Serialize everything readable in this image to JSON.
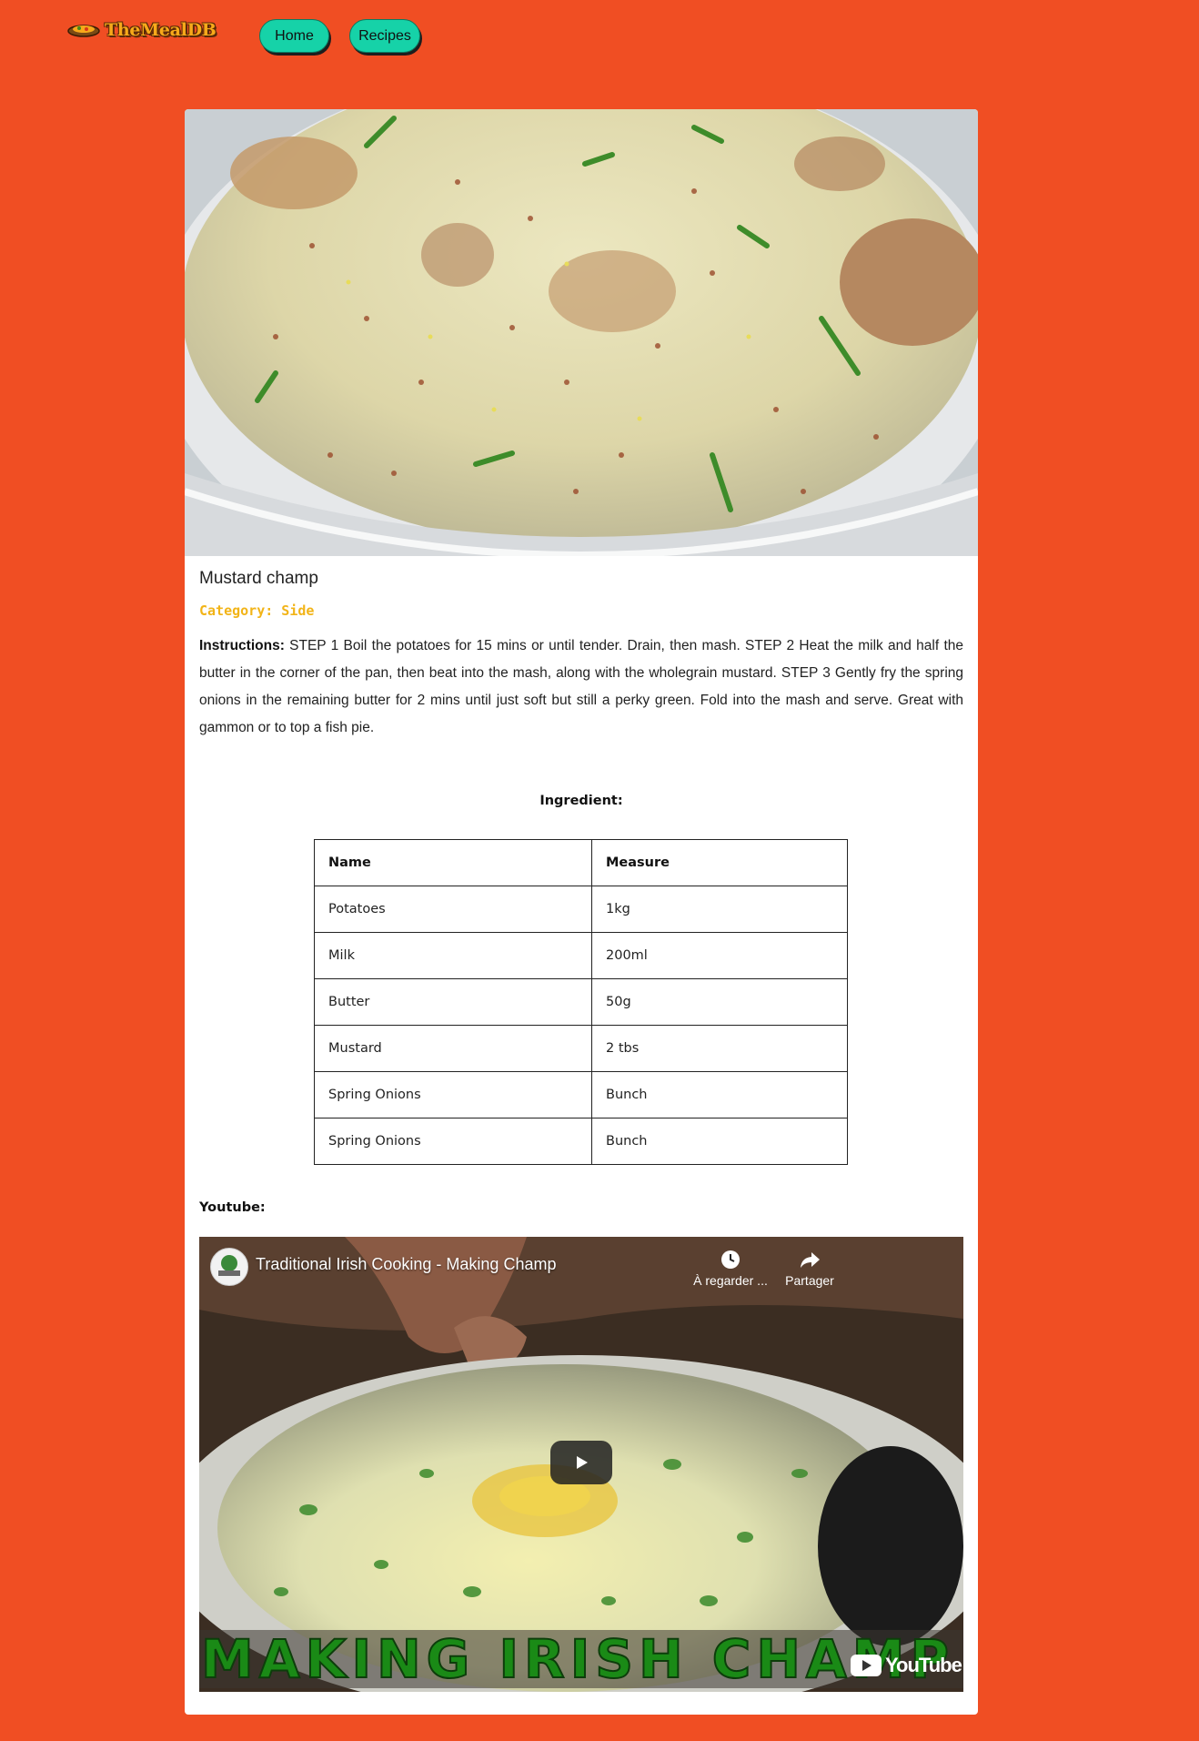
{
  "navbar": {
    "logo_text": "TheMealDB",
    "links": [
      "Home",
      "Recipes"
    ]
  },
  "meal": {
    "title": "Mustard champ",
    "category": "Category: Side",
    "instructions_label": "Instructions:",
    "instructions": "STEP 1 Boil the potatoes for 15 mins or until tender. Drain, then mash. STEP 2 Heat the milk and half the butter in the corner of the pan, then beat into the mash, along with the wholegrain mustard. STEP 3 Gently fry the spring onions in the remaining butter for 2 mins until just soft but still a perky green. Fold into the mash and serve. Great with gammon or to top a fish pie."
  },
  "ingredients": {
    "heading": "Ingredient:",
    "columns": [
      "Name",
      "Measure"
    ],
    "rows": [
      [
        "Potatoes",
        "1kg"
      ],
      [
        "Milk",
        "200ml"
      ],
      [
        "Butter",
        "50g"
      ],
      [
        "Mustard",
        "2 tbs"
      ],
      [
        "Spring Onions",
        "Bunch"
      ],
      [
        "Spring Onions",
        "Bunch"
      ]
    ]
  },
  "youtube": {
    "label": "Youtube:",
    "video_title": "Traditional Irish Cooking - Making Champ",
    "watch_later": "À regarder ...",
    "share": "Partager",
    "banner_text": "MAKING IRISH CHAMP",
    "brand": "YouTube"
  },
  "colors": {
    "page_background": "#f04e23",
    "nav_button": "#16d2a8",
    "category_text": "#f2b418"
  },
  "icons": [
    "dish-logo-icon",
    "clock-icon",
    "share-arrow-icon",
    "play-icon",
    "youtube-logo-icon"
  ]
}
